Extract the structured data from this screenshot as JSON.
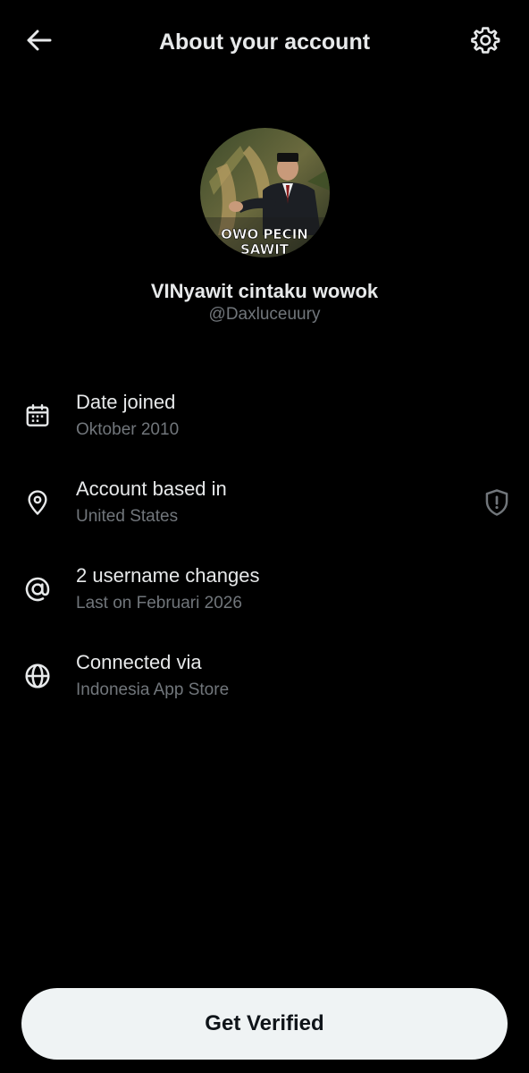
{
  "header": {
    "title": "About your account",
    "back_icon": "arrow-left-icon",
    "settings_icon": "gear-icon"
  },
  "profile": {
    "display_name": "VINyawit cintaku wowok",
    "handle": "@Daxluceuury",
    "avatar_caption_line1": "OWO PECIN",
    "avatar_caption_line2": "SAWIT"
  },
  "info": [
    {
      "icon": "calendar-icon",
      "label": "Date joined",
      "value": "Oktober 2010"
    },
    {
      "icon": "location-pin-icon",
      "label": "Account based in",
      "value": "United States",
      "trailing_icon": "shield-alert-icon"
    },
    {
      "icon": "at-sign-icon",
      "label": "2 username changes",
      "value": "Last on Februari 2026"
    },
    {
      "icon": "globe-icon",
      "label": "Connected via",
      "value": "Indonesia App Store"
    }
  ],
  "footer": {
    "cta_label": "Get Verified"
  },
  "colors": {
    "background": "#000000",
    "primary_text": "#e7e9ea",
    "secondary_text": "#71767b",
    "button_bg": "#eff3f4",
    "button_text": "#0f1419"
  }
}
